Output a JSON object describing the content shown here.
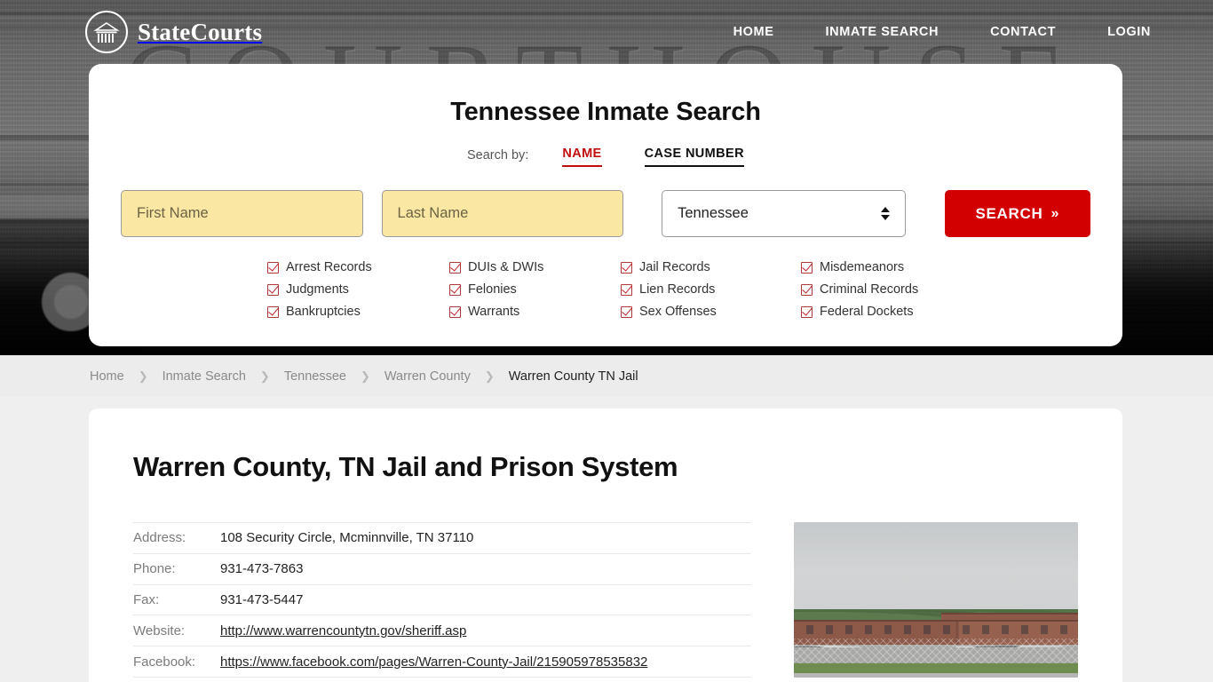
{
  "header": {
    "brand_name": "StateCourts",
    "brand_icon": "courthouse-circle-icon",
    "hero_word": "COURTHOUSE",
    "nav": [
      {
        "label": "HOME"
      },
      {
        "label": "INMATE SEARCH"
      },
      {
        "label": "CONTACT"
      },
      {
        "label": "LOGIN"
      }
    ]
  },
  "search_panel": {
    "title": "Tennessee Inmate Search",
    "search_by_label": "Search by:",
    "tabs": [
      {
        "label": "NAME",
        "active": true
      },
      {
        "label": "CASE NUMBER",
        "active": false
      }
    ],
    "first_name_placeholder": "First Name",
    "first_name_value": "",
    "last_name_placeholder": "Last Name",
    "last_name_value": "",
    "state_selected": "Tennessee",
    "search_button": "SEARCH",
    "search_button_chevron": "»",
    "categories": [
      "Arrest Records",
      "DUIs & DWIs",
      "Jail Records",
      "Misdemeanors",
      "Judgments",
      "Felonies",
      "Lien Records",
      "Criminal Records",
      "Bankruptcies",
      "Warrants",
      "Sex Offenses",
      "Federal Dockets"
    ],
    "accent_color": "#c10d0d",
    "button_color": "#d20000",
    "input_fill": "#fae7a4"
  },
  "breadcrumb": {
    "separator": "❯",
    "items": [
      {
        "label": "Home",
        "current": false
      },
      {
        "label": "Inmate Search",
        "current": false
      },
      {
        "label": "Tennessee",
        "current": false
      },
      {
        "label": "Warren County",
        "current": false
      },
      {
        "label": "Warren County TN Jail",
        "current": true
      }
    ]
  },
  "content": {
    "page_title": "Warren County, TN Jail and Prison System",
    "info_rows": [
      {
        "label": "Address:",
        "value": "108 Security Circle, Mcminnville, TN 37110",
        "link": false
      },
      {
        "label": "Phone:",
        "value": "931-473-7863",
        "link": false
      },
      {
        "label": "Fax:",
        "value": "931-473-5447",
        "link": false
      },
      {
        "label": "Website:",
        "value": "http://www.warrencountytn.gov/sheriff.asp",
        "link": true
      },
      {
        "label": "Facebook:",
        "value": "https://www.facebook.com/pages/Warren-County-Jail/215905978535832",
        "link": true
      }
    ],
    "photo_alt": "warren-county-jail-photo"
  }
}
